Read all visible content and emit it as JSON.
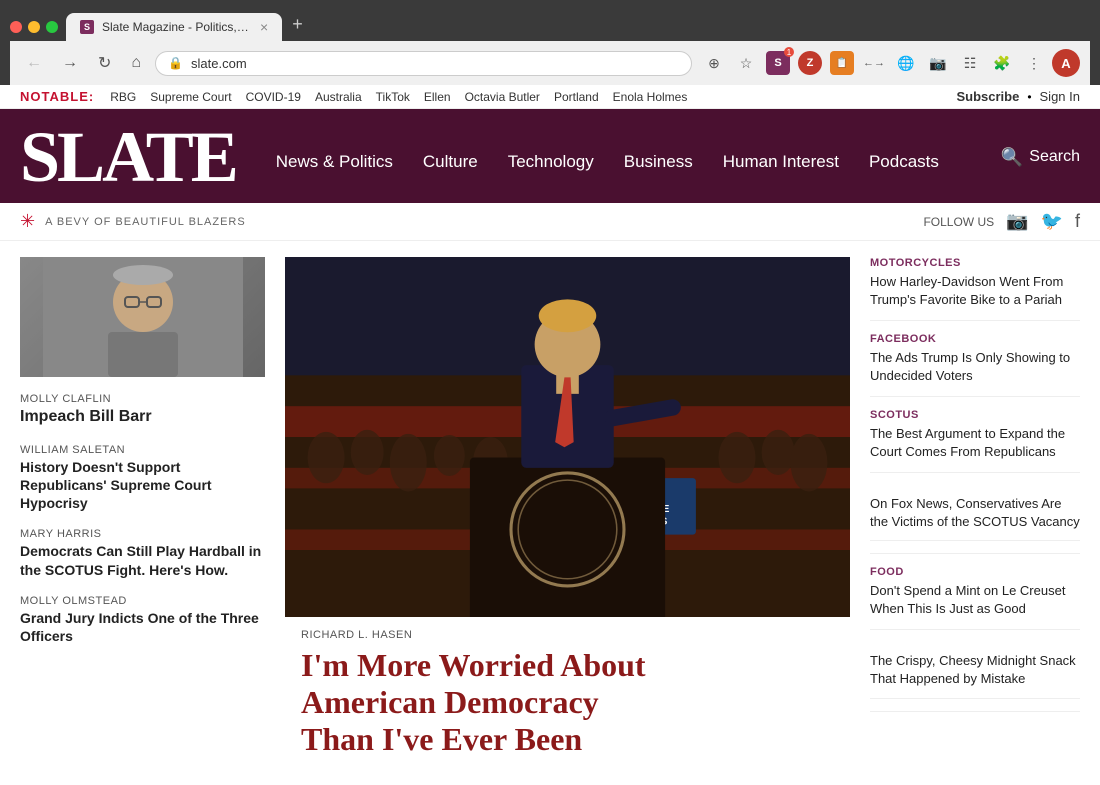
{
  "browser": {
    "tab_icon": "S",
    "tab_title": "Slate Magazine - Politics, Busi…",
    "address": "slate.com",
    "new_tab_label": "+"
  },
  "topbar": {
    "notable_label": "NOTABLE:",
    "links": [
      "RBG",
      "Supreme Court",
      "COVID-19",
      "Australia",
      "TikTok",
      "Ellen",
      "Octavia Butler",
      "Portland",
      "Enola Holmes"
    ],
    "subscribe_label": "Subscribe",
    "dot": "•",
    "signin_label": "Sign In"
  },
  "header": {
    "logo": "SLATE",
    "search_label": "Search",
    "nav_items": [
      "News & Politics",
      "Culture",
      "Technology",
      "Business",
      "Human Interest",
      "Podcasts"
    ]
  },
  "ad_banner": {
    "logo_symbol": "✳",
    "ad_text": "A BEVY OF BEAUTIFUL BLAZERS",
    "follow_us": "FOLLOW US"
  },
  "left_sidebar": {
    "article1": {
      "author": "MOLLY CLAFLIN",
      "headline": "Impeach Bill Barr"
    },
    "article2": {
      "author": "WILLIAM SALETAN",
      "headline": "History Doesn't Support Republicans' Supreme Court Hypocrisy"
    },
    "article3": {
      "author": "MARY HARRIS",
      "headline": "Democrats Can Still Play Hardball in the SCOTUS Fight. Here's How."
    },
    "article4": {
      "author": "MOLLY OLMSTEAD",
      "headline": "Grand Jury Indicts One of the Three Officers"
    }
  },
  "hero": {
    "author": "RICHARD L. HASEN",
    "title_line1": "I'm More Worried About",
    "title_line2": "American Democracy",
    "title_line3": "Than I've Ever Been"
  },
  "right_sidebar": {
    "articles": [
      {
        "category": "MOTORCYCLES",
        "headline": "How Harley-Davidson Went From Trump's Favorite Bike to a Pariah"
      },
      {
        "category": "FACEBOOK",
        "headline": "The Ads Trump Is Only Showing to Undecided Voters"
      },
      {
        "category": "SCOTUS",
        "headline": "The Best Argument to Expand the Court Comes From Republicans"
      },
      {
        "category": "",
        "headline": "On Fox News, Conservatives Are the Victims of the SCOTUS Vacancy"
      },
      {
        "category": "FOOD",
        "headline": "Don't Spend a Mint on Le Creuset When This Is Just as Good"
      },
      {
        "category": "",
        "headline": "The Crispy, Cheesy Midnight Snack That Happened by Mistake"
      }
    ]
  }
}
